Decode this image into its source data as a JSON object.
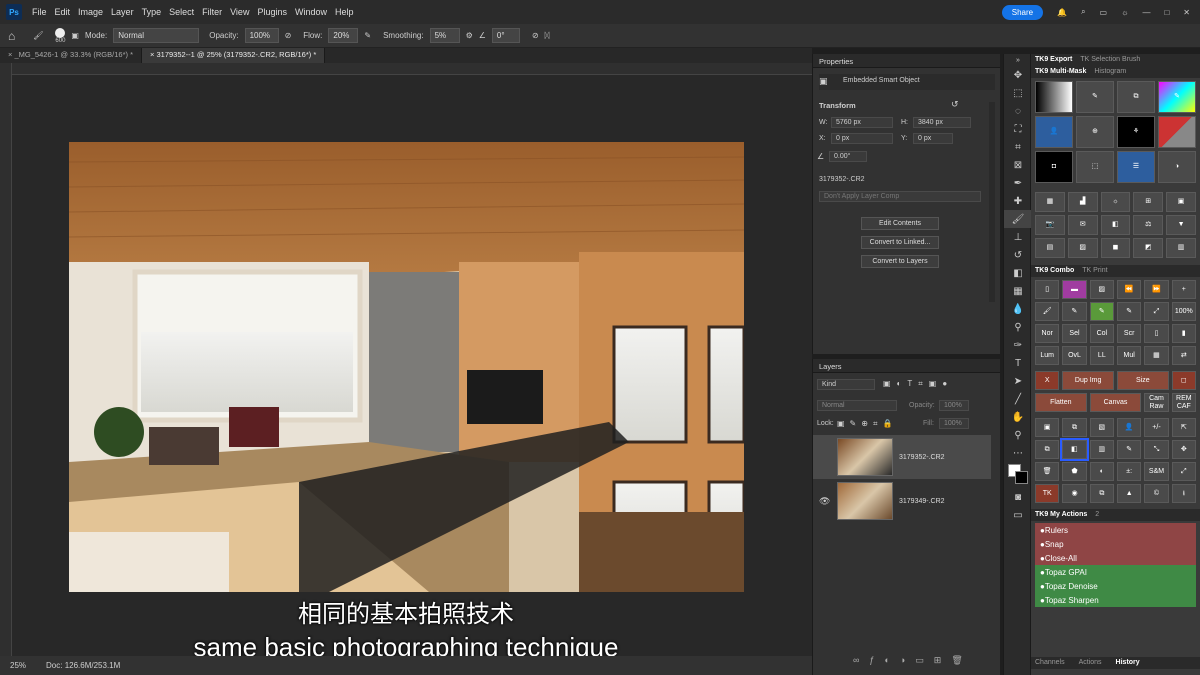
{
  "app": {
    "logo": "Ps",
    "menus": [
      "File",
      "Edit",
      "Image",
      "Layer",
      "Type",
      "Select",
      "Filter",
      "View",
      "Plugins",
      "Window",
      "Help"
    ],
    "share": "Share"
  },
  "options": {
    "brush_size": "600",
    "mode_label": "Mode:",
    "mode_value": "Normal",
    "opacity_label": "Opacity:",
    "opacity_value": "100%",
    "flow_label": "Flow:",
    "flow_value": "20%",
    "smoothing_label": "Smoothing:",
    "smoothing_value": "5%",
    "angle_value": "0°"
  },
  "tabs": [
    "_MG_5426-1 @ 33.3% (RGB/16*) *",
    "3179352--1 @ 25% (3179352-.CR2, RGB/16*) *"
  ],
  "status": {
    "zoom": "25%",
    "doc": "Doc: 126.6M/253.1M"
  },
  "properties": {
    "title": "Properties",
    "type": "Embedded Smart Object",
    "transform": "Transform",
    "w_label": "W:",
    "w_value": "5760 px",
    "h_label": "H:",
    "h_value": "3840 px",
    "x_label": "X:",
    "x_value": "0 px",
    "y_label": "Y:",
    "y_value": "0 px",
    "angle": "0.00°",
    "filename": "3179352-.CR2",
    "layer_comp": "Don't Apply Layer Comp",
    "btn_edit": "Edit Contents",
    "btn_linked": "Convert to Linked...",
    "btn_layers": "Convert to Layers"
  },
  "layers": {
    "title": "Layers",
    "kind": "Kind",
    "mode": "Normal",
    "opacity_label": "Opacity:",
    "opacity_value": "100%",
    "lock": "Lock:",
    "fill_label": "Fill:",
    "fill_value": "100%",
    "items": [
      "3179352-.CR2",
      "3179349-.CR2"
    ]
  },
  "tk9": {
    "tabs1": [
      "TK9 Export",
      "TK Selection Brush"
    ],
    "tabs2": [
      "TK9 Multi-Mask",
      "Histogram"
    ],
    "combo_tabs": [
      "TK9 Combo",
      "TK Print"
    ],
    "row_labels1": [
      "Nor",
      "Sel",
      "Col",
      "Scr"
    ],
    "row_labels2": [
      "Lum",
      "OvL",
      "LL",
      "Mul"
    ],
    "pct": "100%",
    "dup": "Dup Img",
    "size": "Size",
    "flatten": "Flatten",
    "canvas": "Canvas",
    "cam": "Cam Raw",
    "rem": "REM CAF",
    "pm": "+/-",
    "x": "X",
    "sm": "S&M",
    "pmi": "±:",
    "tk": "TK",
    "actions_tabs": [
      "TK9 My Actions",
      "2"
    ],
    "actions": [
      "●Rulers",
      "●Snap",
      "●Close-All",
      "●Topaz GPAI",
      "●Topaz Denoise",
      "●Topaz Sharpen"
    ],
    "bottom_tabs": [
      "Channels",
      "Actions",
      "History"
    ]
  },
  "subtitle": {
    "zh": "相同的基本拍照技术",
    "en": "same basic photographing technique"
  }
}
